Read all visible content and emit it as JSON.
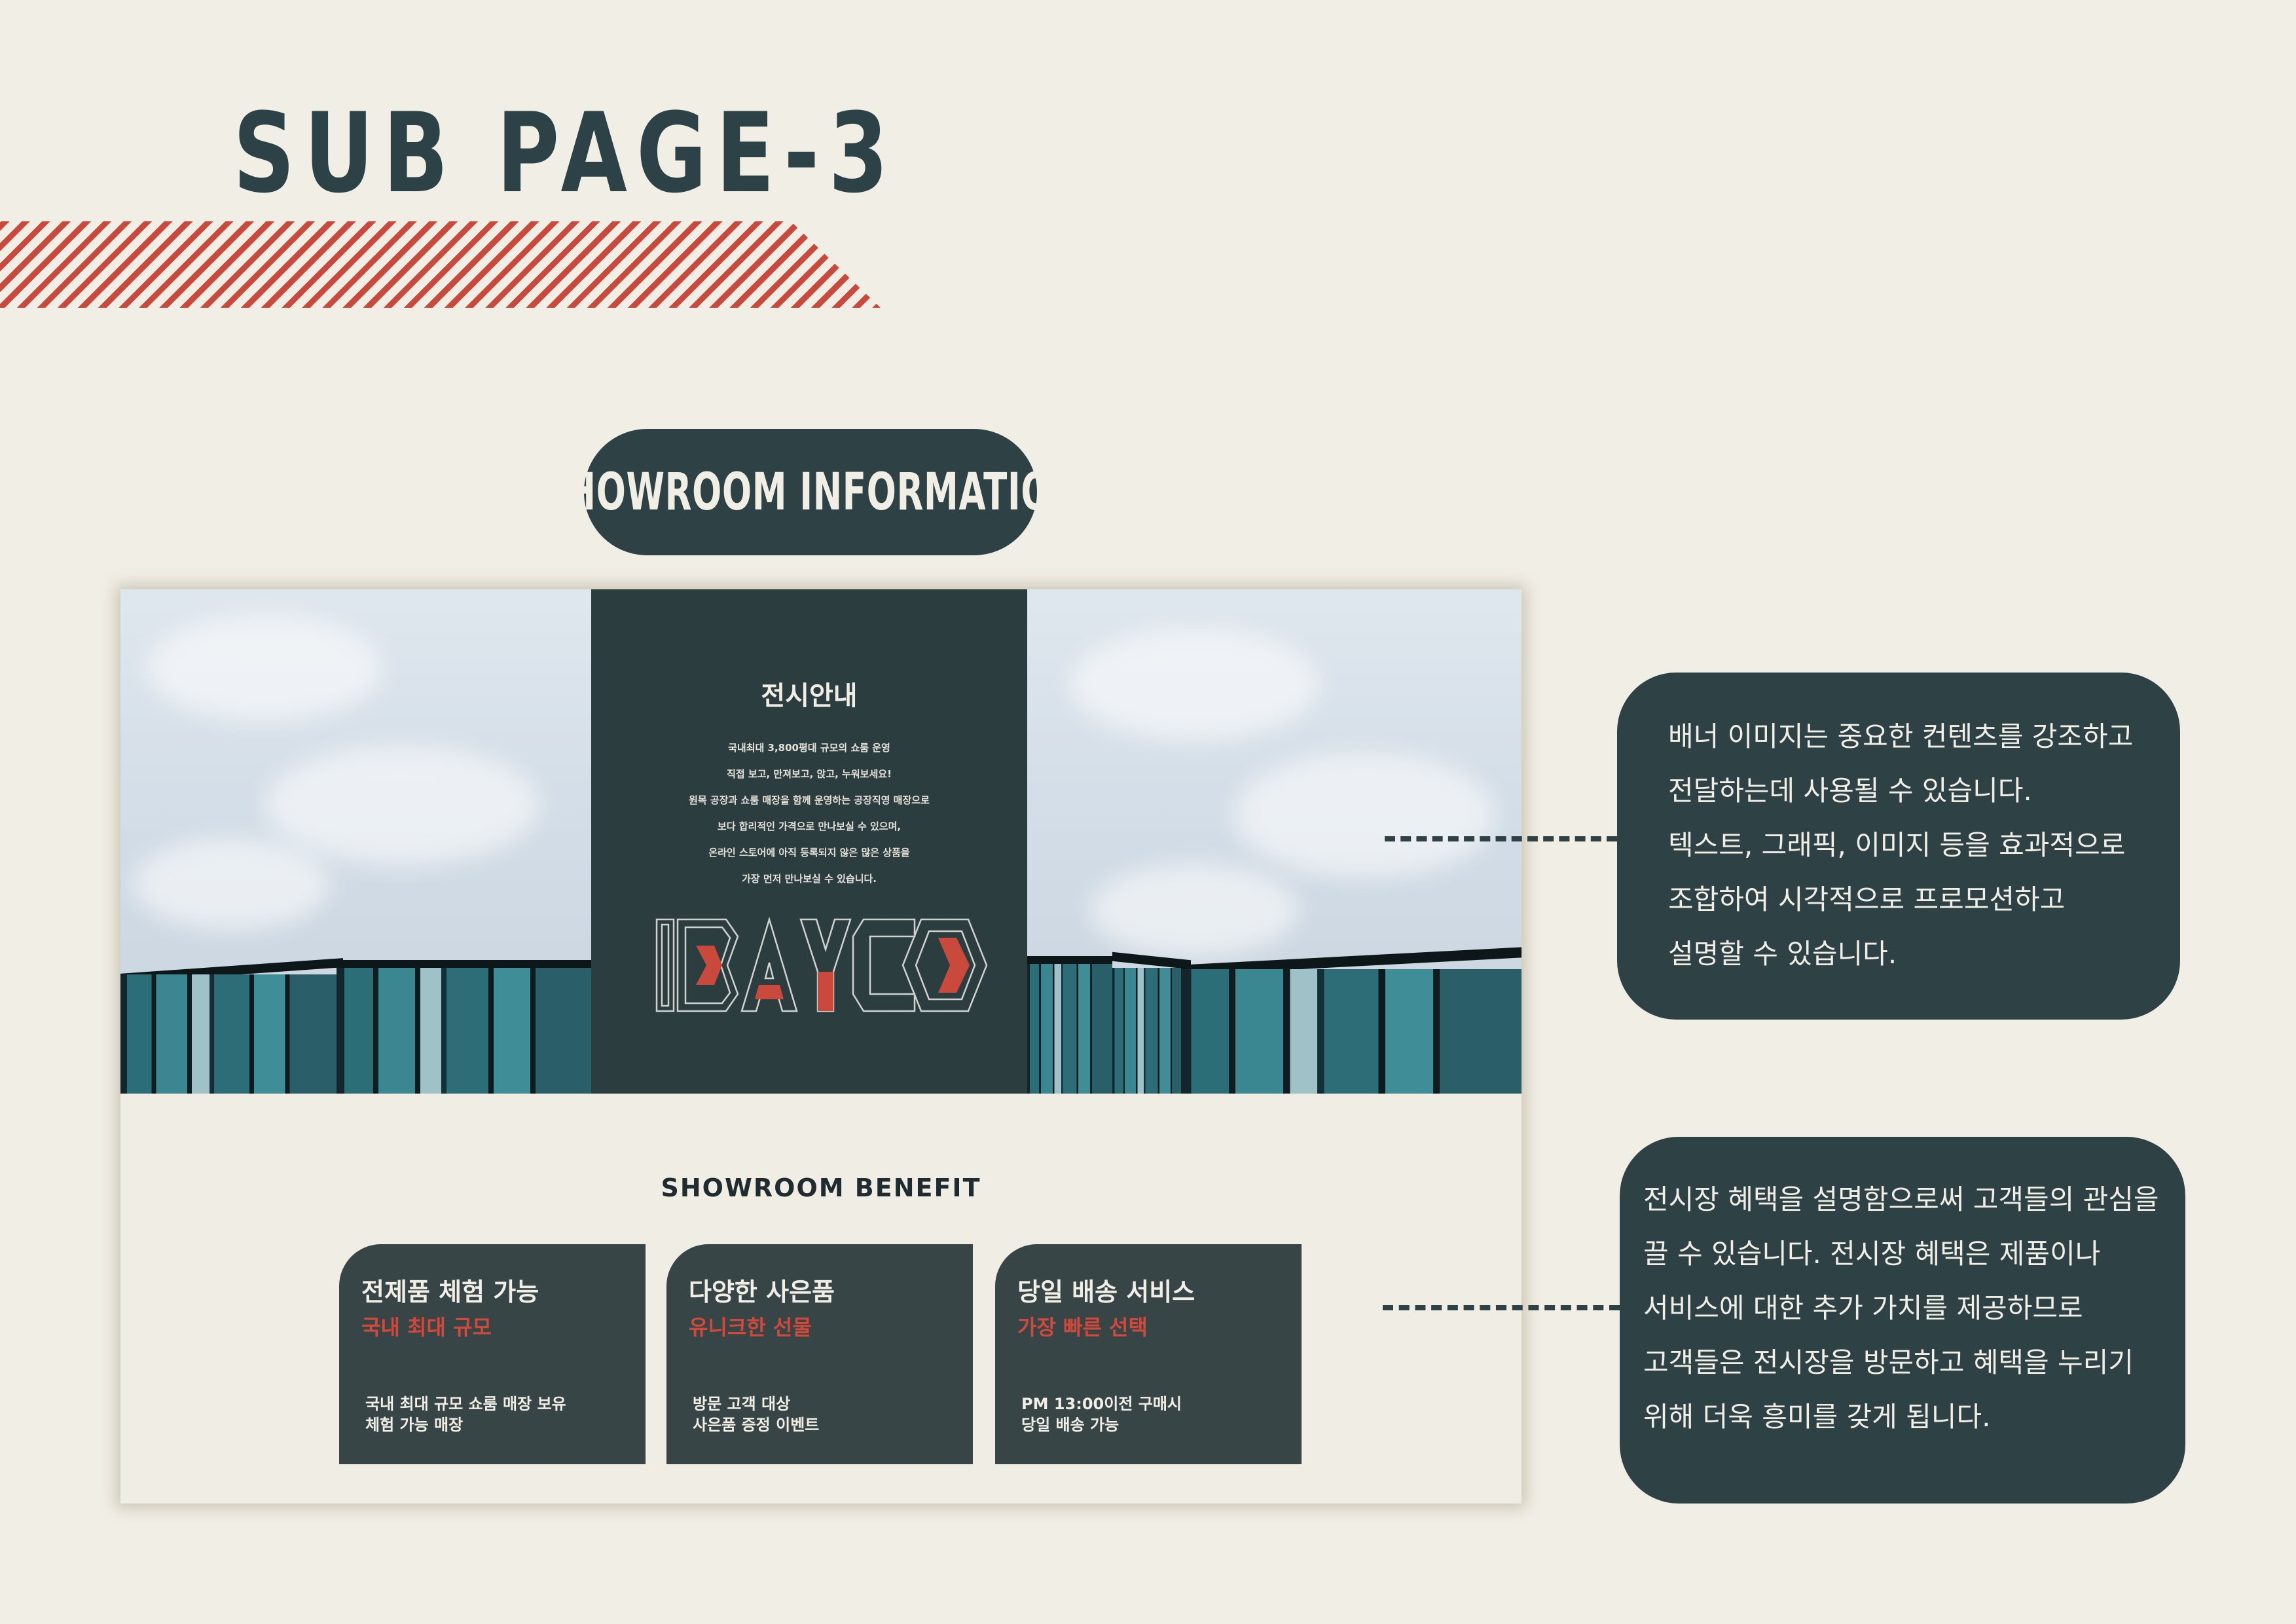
{
  "header": {
    "title": "SUB PAGE-3"
  },
  "section": {
    "pill_label": "SHOWROOM INFORMATION"
  },
  "banner": {
    "title": "전시안내",
    "lines": [
      "국내최대 3,800평대 규모의 쇼룸 운영",
      "직접 보고, 만져보고, 앉고, 누워보세요!",
      "원목 공장과 쇼룸 매장을 함께 운영하는 공장직영 매장으로",
      "보다 합리적인 가격으로 만나보실 수 있으며,",
      "온라인 스토어에 아직 등록되지 않은 많은 상품을",
      "가장 먼저 만나보실 수 있습니다."
    ],
    "logo_text": "BAYCO"
  },
  "benefits": {
    "heading": "SHOWROOM BENEFIT",
    "cards": [
      {
        "title": "전제품 체험 가능",
        "subtitle": "국내 최대 규모",
        "desc": [
          "국내 최대 규모 쇼룸 매장 보유",
          "체험 가능 매장"
        ]
      },
      {
        "title": "다양한 사은품",
        "subtitle": "유니크한 선물",
        "desc": [
          "방문 고객 대상",
          "사은품 증정 이벤트"
        ]
      },
      {
        "title": "당일 배송 서비스",
        "subtitle": "가장 빠른 선택",
        "desc": [
          "PM 13:00이전 구매시",
          "당일 배송 가능"
        ]
      }
    ]
  },
  "callouts": [
    {
      "lines": [
        "배너 이미지는 중요한 컨텐츠를 강조하고",
        "전달하는데 사용될 수 있습니다.",
        "텍스트, 그래픽, 이미지 등을 효과적으로",
        "조합하여 시각적으로 프로모션하고",
        "설명할 수 있습니다."
      ]
    },
    {
      "lines": [
        "전시장 혜택을 설명함으로써 고객들의 관심을",
        "끌 수 있습니다. 전시장 혜택은 제품이나",
        "서비스에 대한 추가 가치를 제공하므로",
        "고객들은 전시장을 방문하고 혜택을 누리기",
        "위해 더욱 흥미를 갖게 됩니다."
      ]
    }
  ],
  "colors": {
    "background": "#f1eee6",
    "dark_teal": "#2e4245",
    "accent_red": "#c9493c"
  }
}
